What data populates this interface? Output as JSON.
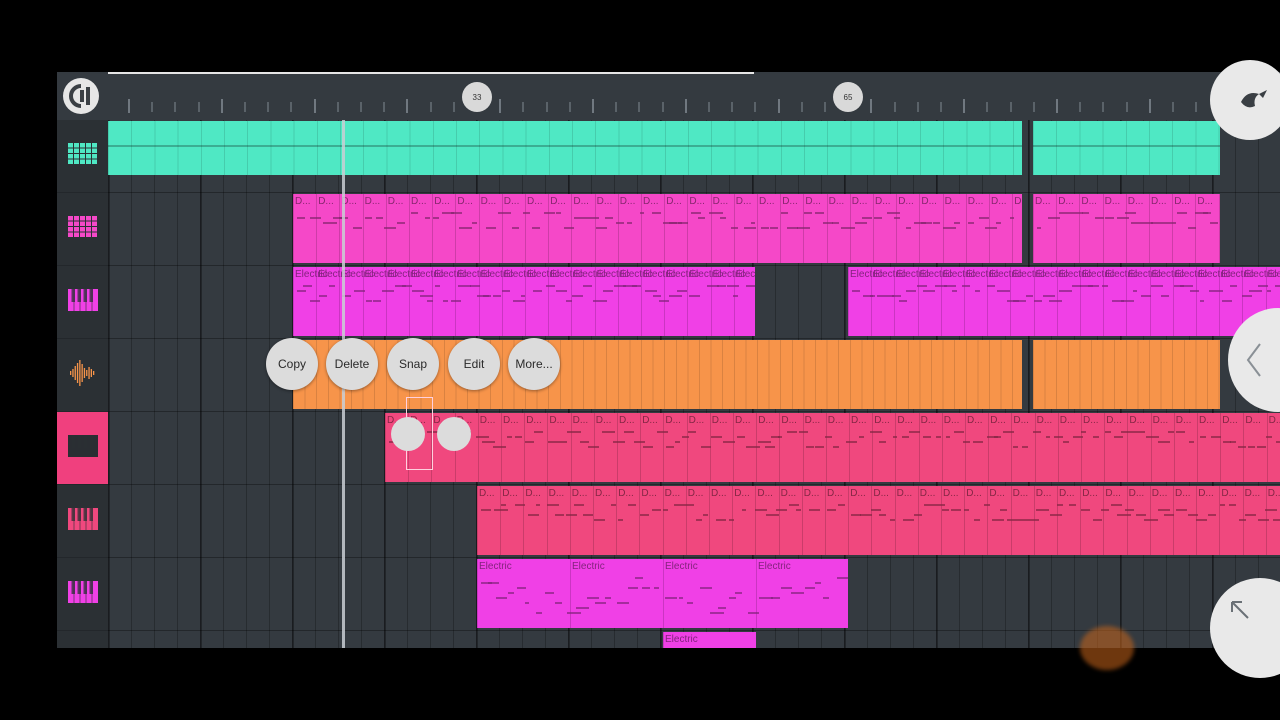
{
  "ruler": {
    "bar_markers": [
      {
        "label": "33",
        "position": "bar-33"
      },
      {
        "label": "65",
        "position": "bar-65"
      }
    ]
  },
  "icons": {
    "logo": "fl-studio-logo-icon",
    "track_types": [
      "pattern-grid-icon",
      "pattern-grid-icon",
      "piano-keys-icon",
      "audio-waveform-icon",
      "piano-keys-icon",
      "piano-keys-icon",
      "piano-keys-icon",
      "piano-keys-icon"
    ],
    "side": [
      "fruit-logo-icon",
      "chevron-left-icon",
      "arrow-up-left-icon"
    ]
  },
  "tracks": [
    {
      "type": "pattern",
      "color": "#4fe8c4",
      "clip_label": ""
    },
    {
      "type": "pattern",
      "color": "#f548c8",
      "clip_label": "D..."
    },
    {
      "type": "piano",
      "color": "#f040e6",
      "clip_label": "Electric"
    },
    {
      "type": "audio",
      "color": "#f7944a",
      "clip_label": ""
    },
    {
      "type": "piano",
      "color": "#f0487e",
      "clip_label": "D...",
      "selected": true
    },
    {
      "type": "piano",
      "color": "#f0487e",
      "clip_label": "D..."
    },
    {
      "type": "piano",
      "color": "#f040e6",
      "clip_label": "Electric"
    },
    {
      "type": "piano",
      "color": "#f040e6",
      "clip_label": "Electric"
    }
  ],
  "context_menu": {
    "copy": "Copy",
    "delete": "Delete",
    "snap": "Snap",
    "edit": "Edit",
    "more": "More..."
  },
  "colors": {
    "background": "#343a40",
    "selected_track": "#f0407e"
  }
}
